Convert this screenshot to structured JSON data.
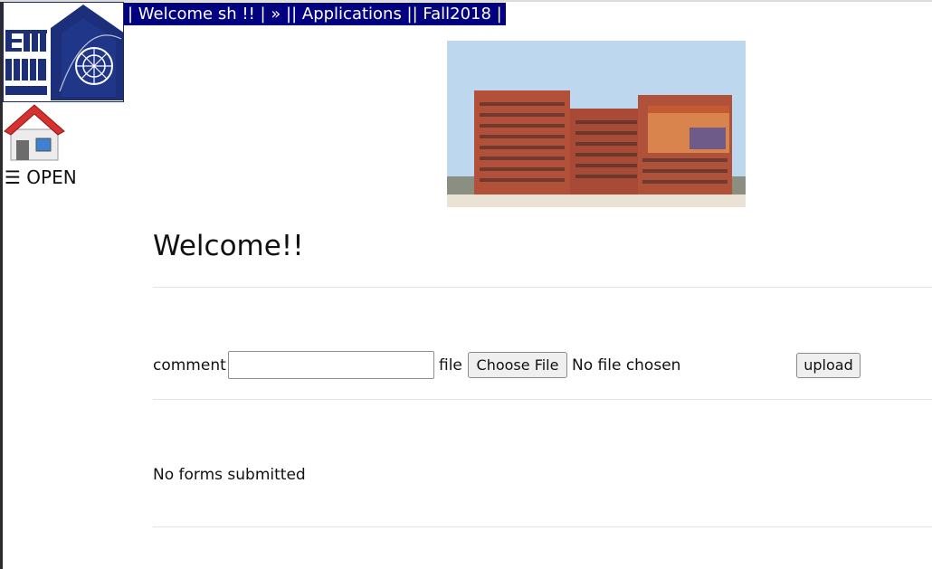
{
  "header": {
    "logo_alt": "EAST WEST UNIVERSITY excellence in education",
    "nav_text": "| Welcome sh !! | » || Applications || Fall2018 |",
    "nav_bg": "#000080"
  },
  "sidebar": {
    "home_icon": "home-icon",
    "open_label": "☰ OPEN"
  },
  "main": {
    "title": "Welcome!!",
    "form": {
      "comment_label": "comment",
      "comment_value": "",
      "file_label": "file",
      "choose_file_label": "Choose File",
      "no_file_text": "No file chosen",
      "upload_label": "upload"
    },
    "empty_message": "No forms submitted"
  }
}
